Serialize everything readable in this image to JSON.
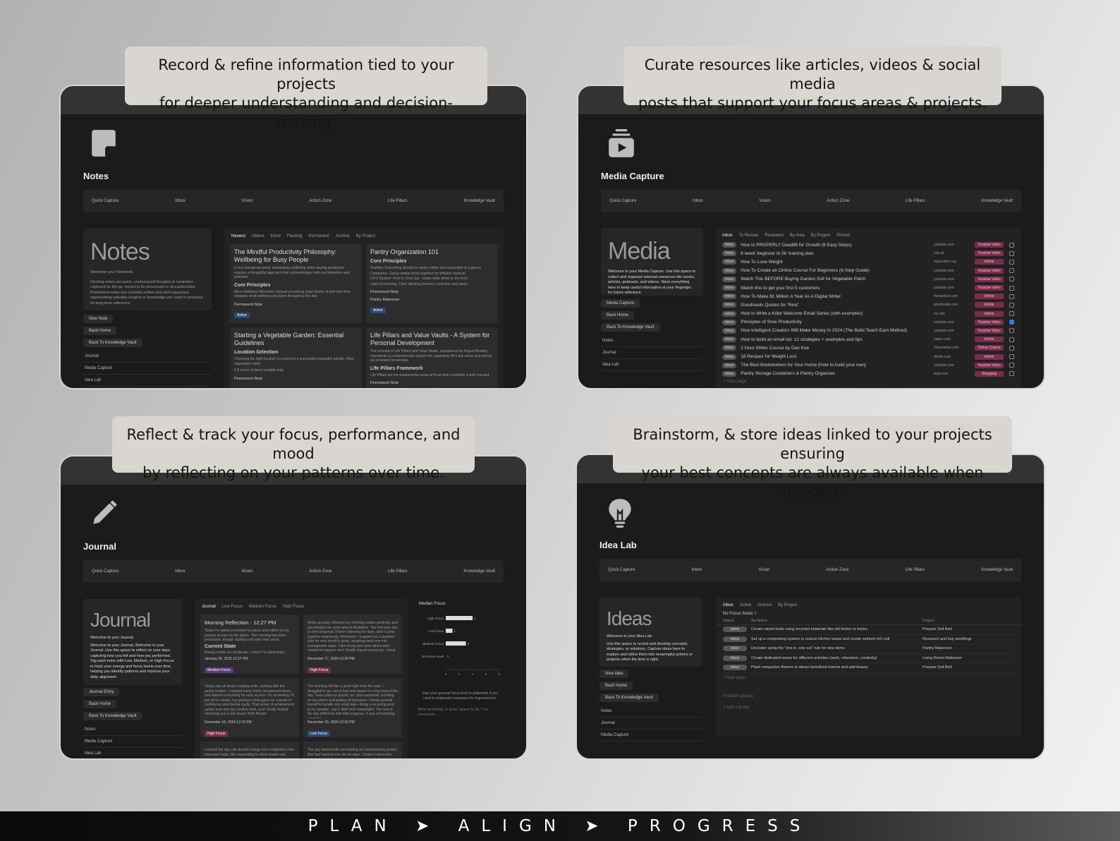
{
  "captions": {
    "notes": [
      "Record & refine information tied to your projects",
      "for deeper understanding and decision-making."
    ],
    "media": [
      "Curate resources like articles, videos & social media",
      "posts that support your focus areas & projects."
    ],
    "journal": [
      "Reflect & track your focus, performance, and mood",
      "by reflecting on  your patterns over time."
    ],
    "idea": [
      "Brainstorm, & store ideas linked to your projects ensuring",
      "your best concepts are always available when needed."
    ]
  },
  "nav": [
    "Quick Capture",
    "Inbox",
    "Vision",
    "Action Zone",
    "Life Pillars",
    "Knowledge Vault"
  ],
  "notes": {
    "title": "Notes",
    "big": "Notes",
    "intro": "Welcome your Notebook.",
    "desc": "Fleeting notes are quick, unstructured thoughts & reminders captured on the go, meant to be processed or discarded later. Permanent notes are carefully written and well-organized, representing valuable insights or knowledge you want to preserve for long-term reference.",
    "buttons": [
      "New Note",
      "Back Home",
      "Back To Knowledge Vault"
    ],
    "links": [
      "Journal",
      "Media Capture",
      "Idea Lab"
    ],
    "tabs": [
      "Newest",
      "Oldest",
      "Inbox",
      "Fleeting",
      "Permanent",
      "Archive",
      "By Project"
    ],
    "cards": [
      {
        "title": "The Mindful Productivity Philosophy: Wellbeing for Busy People",
        "body": "In our fast-paced world, maintaining wellbeing while staying productive requires a thoughtful approach that acknowledges both our limitations and potential.",
        "sub": "Core Principles",
        "items": [
          "Micro-Wellness Moments: Instead of seeking large blocks of self-care time, integrate small wellness practices throughout the day."
        ],
        "tag": "Permanent Note",
        "badge": "Active"
      },
      {
        "title": "Pantry Organization 101",
        "sub": "Core Principles",
        "items": [
          "Visibility: Everything should be easily visible and accessible at a glance",
          "Categories: Group similar items together for efficient retrieval",
          "FIFO System: First In, First Out - rotate older items to the front",
          "Label Everything: Clear labeling prevents confusion and waste"
        ],
        "tag": "Permanent Note",
        "project": "Pantry Makeover",
        "badge": "Active"
      },
      {
        "title": "Starting a Vegetable Garden: Essential Guidelines",
        "sub": "Location Selection",
        "body": "Choosing the right location is crucial for a successful vegetable garden. Most vegetables need:",
        "items": [
          "6-8 hours of direct sunlight daily"
        ],
        "tag": "Permanent Note"
      },
      {
        "title": "Life Pillars and Value Vaults - A System for Personal Development",
        "body": "The concept of Life Pillars and Value Vaults, popularized by August Bradley, represents a comprehensive system for organizing life's key areas and storing accumulated knowledge.",
        "sub": "Life Pillars Framework",
        "body2": "Life Pillars are the fundamental areas of focus that constitute a well-rounded",
        "tag": "Permanent Note"
      }
    ]
  },
  "media": {
    "title": "Media Capture",
    "big": "Media",
    "desc": "Welcome to your Media Capture. Use this space to collect and organize external resources like books, articles, podcasts, and videos. Store everything here to keep useful information at your fingertips for future reference.",
    "buttons": [
      "Media Capture",
      "Back Home",
      "Back To Knowledge Vault"
    ],
    "links": [
      "Notes",
      "Journal",
      "Idea Lab"
    ],
    "tabs": [
      "Inbox",
      "To Review",
      "Reviewed",
      "By Area",
      "By Project",
      "Pinned"
    ],
    "status": "Inbox",
    "rows": [
      {
        "t": "How to PROPERLY Deadlift for Growth (6 Easy Steps)",
        "u": "youtube.com",
        "g": "Youtube Video",
        "c": false
      },
      {
        "t": "6 week 'beginner to 5k' training plan",
        "u": "nhs.uk",
        "g": "Youtube Video",
        "c": false
      },
      {
        "t": "How To Lose Weight",
        "u": "mayoclinic.org",
        "g": "Article",
        "c": false
      },
      {
        "t": "How To Create an Online Course For Beginners (6-Step Guide)",
        "u": "youtube.com",
        "g": "Youtube Video",
        "c": false
      },
      {
        "t": "Watch This BEFORE Buying Garden Soil for Vegetable Patch",
        "u": "youtube.com",
        "g": "Youtube Video",
        "c": false
      },
      {
        "t": "Watch this to get your first 5 customers",
        "u": "youtube.com",
        "g": "Youtube Video",
        "c": false
      },
      {
        "t": "How To Make $1 Million A Year As A Digital Writer",
        "u": "thedankoe.com",
        "g": "Article",
        "c": false
      },
      {
        "t": "Goodreads Quotes for 'Rest'",
        "u": "goodreads.com",
        "g": "Article",
        "c": false
      },
      {
        "t": "How to Write a Killer Welcome Email Series (with examples)",
        "u": "ck.com",
        "g": "Article",
        "c": false
      },
      {
        "t": "Principles of Slow Productivity",
        "u": "youtube.com",
        "g": "Youtube Video",
        "c": true
      },
      {
        "t": "How Intelligent Creators Will Make Money In 2024 (The Build Teach Earn Method)",
        "u": "youtube.com",
        "g": "Youtube Video",
        "c": false
      },
      {
        "t": "How to build an email list: 12 strategies + examples and tips",
        "u": "zapier.com",
        "g": "Article",
        "c": false
      },
      {
        "t": "2 Hour Writer Course by Dan Koe",
        "u": "2hourwriter.com",
        "g": "Online Course",
        "c": false
      },
      {
        "t": "18 Recipes for Weight Loss",
        "u": "delish.com",
        "g": "Article",
        "c": false
      },
      {
        "t": "The Best Bookshelves for Your Home [How to build your own]",
        "u": "youtube.com",
        "g": "Youtube Video",
        "c": false
      },
      {
        "t": "Pantry Storage Containers & Pantry Organiser",
        "u": "ikea.com",
        "g": "Shopping",
        "c": false
      }
    ],
    "newpage": "+ New page"
  },
  "journal": {
    "title": "Journal",
    "big": "Journal",
    "intro": "Welcome to your Journal.",
    "desc": "Welcome to your Journal. Welcome to your Journal. Use this space to reflect on your days, capturing how you felt and how you performed. Tag each entry with Low, Medium, or High Focus to track your energy and focus levels over time, helping you identify patterns and improve your daily alignment.",
    "buttons": [
      "Journal Entry",
      "Back Home",
      "Back To Knowledge Vault"
    ],
    "links": [
      "Notes",
      "Media Capture",
      "Idea Lab"
    ],
    "tabs": [
      "Journal",
      "Low Focus",
      "Medium Focus",
      "High Focus"
    ],
    "cards": [
      {
        "title": "Morning Reflection - 12:27 PM",
        "body": "Today I'm taking a moment to pause and reflect on my journey across my life pillars. The morning has been productive, though starting a bit later than usual.",
        "sub": "Current State",
        "body2": "Energy levels are moderate. I notice I'm particularly",
        "date": "January 30, 2025 12:27 PM",
        "badge": "Medium Focus",
        "bc": "#5b3a7a"
      },
      {
        "title": "",
        "body": "Woke up early, followed my morning routine perfectly, and got straight into work without hesitation. The first task was a client proposal I'd been planning for days, and it came together seamlessly. Afterward, I mapped out a detailed plan for next month's goals, breaking each one into manageable steps. I felt strong and clear about what needed to happen next. Health stayed strong too—meal",
        "date": "December 17, 2024 12:36 PM",
        "badge": "High Focus",
        "bc": "#7a2d4a"
      },
      {
        "title": "",
        "body": "Today was all about creating order, starting with the pantry project. I emptied every shelf, reorganized items, and labeled everything for easy access. It's something I'd put off for weeks, but getting it done gave me a boost of confidence and mental clarity. That sense of achievement spilled over into my creative work, and I finally started sketching out a new board. Both flowed",
        "date": "December 16, 2024 12:15 PM",
        "badge": "High Focus",
        "bc": "#7a2d4a"
      },
      {
        "title": "",
        "body": "The morning felt like a grind right from the start. I struggled to get out of bed and stayed in a fog most of the day. Tasks piled up quickly as I procrastinated, scrolling on my phone and putting off decisions. I finally pushed myself to handle one small task—fixing a recurring error in my website - but it didn't feel meaningful. The rest of the day drifted by with little progress. It was a frustrating reminder",
        "date": "December 15, 2024 12:15 PM",
        "badge": "Low Focus",
        "bc": "#2a4a7a"
      },
      {
        "title": "",
        "body": "I started the day with decent energy and completed a few important tasks, like responding to client emails and",
        "date": "",
        "badge": "",
        "bc": ""
      },
      {
        "title": "",
        "body": "The day started with me tackling an overwhelming project that had loomed over me for days. I broke it down into",
        "date": "",
        "badge": "",
        "bc": ""
      }
    ],
    "chart": {
      "title": "Median Focus",
      "hint": "View your general focus level to determine if you need to implement measures for improvement.",
      "ai": "Write something, or press 'space' for AI, '/' for commands..."
    }
  },
  "chart_data": {
    "type": "bar",
    "orientation": "horizontal",
    "title": "Median Focus",
    "categories": [
      "High Focus",
      "Low Focus",
      "Medium Focus",
      "No Focus Level"
    ],
    "values": [
      4,
      1,
      3,
      0
    ],
    "xticks": [
      0,
      2,
      4,
      6,
      8
    ],
    "xlim": [
      0,
      8
    ]
  },
  "idea": {
    "title": "Idea Lab",
    "big": "Ideas",
    "intro": "Welcome to your Idea Lab.",
    "desc": "Use this space to record and develop concepts, strategies, or solutions. Capture ideas here to explore and refine them into meaningful actions or projects when the time is right.",
    "buttons": [
      "New Idea",
      "Back Home",
      "Back To Knowledge Vault"
    ],
    "links": [
      "Notes",
      "Journal",
      "Media Capture"
    ],
    "tabs": [
      "Inbox",
      "Active",
      "Archive",
      "By Project"
    ],
    "group": "No Focus Areas",
    "groupCount": "5",
    "cols": [
      "Status",
      "Aa Name",
      "Project"
    ],
    "rows": [
      {
        "t": "Create raised beds using recycled materials like old timber or bricks",
        "p": "Prepare Soil Bed"
      },
      {
        "t": "Set up a composting system to reduce kitchen waste and create nutrient-rich soil",
        "p": "Research and buy seedlings"
      },
      {
        "t": "Declutter using the \"one in, one out\" rule for new items",
        "p": "Pantry Makeover"
      },
      {
        "t": "Create dedicated zones for different activities (work, relaxation, creativity)",
        "p": "Living Room Makeover"
      },
      {
        "t": "Plant companion flowers to attract beneficial insects and add beauty",
        "p": "Prepare Soil Bed"
      }
    ],
    "status": "Inbox",
    "newpage": "+ New page",
    "hidden": "4 hidden groups",
    "addgroup": "+ Add a group"
  },
  "footer": "PLAN ➤ ALIGN ➤ PROGRESS"
}
